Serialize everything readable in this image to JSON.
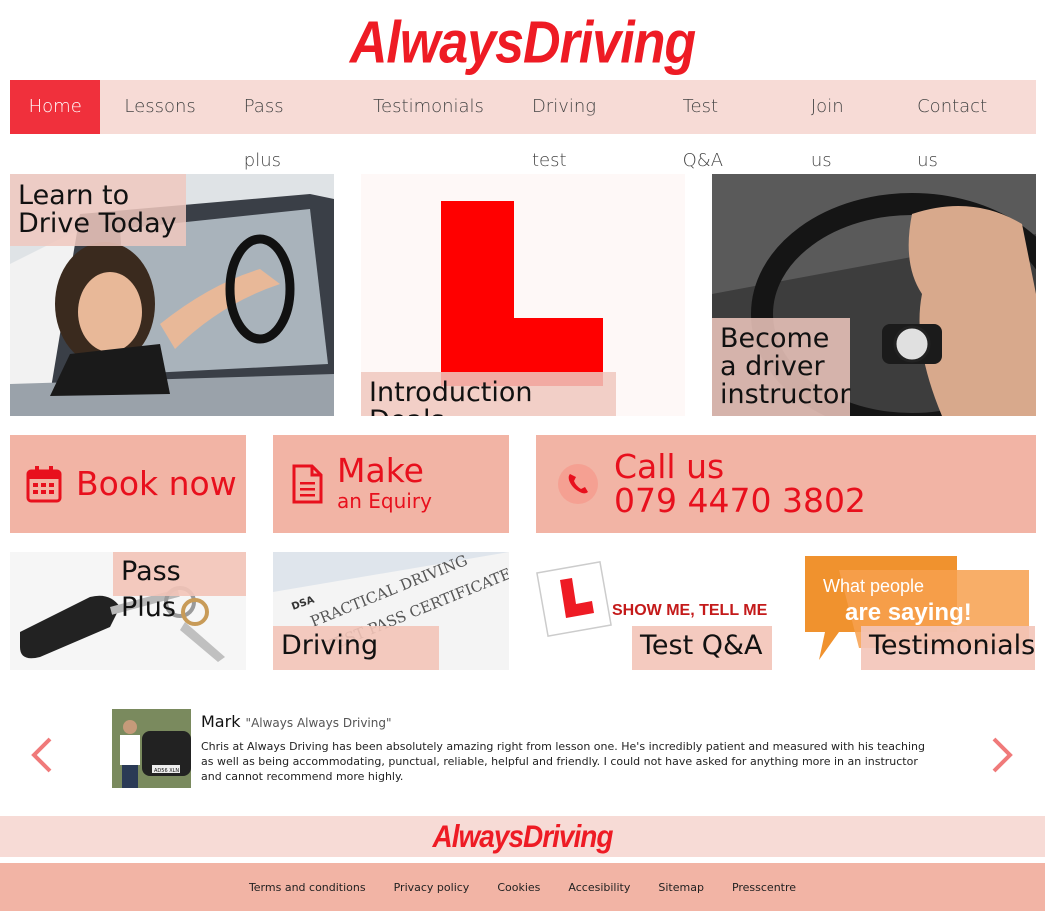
{
  "logo": {
    "text": "AlwaysDriving"
  },
  "nav": {
    "items": [
      {
        "label": "Home"
      },
      {
        "label": "Lessons"
      },
      {
        "label": "Pass plus"
      },
      {
        "label": "Testimonials"
      },
      {
        "label": "Driving test"
      },
      {
        "label": "Test Q&A"
      },
      {
        "label": "Join us"
      },
      {
        "label": "Contact us"
      }
    ]
  },
  "hero": {
    "learn": {
      "line1": "Learn to",
      "line2": "Drive Today"
    },
    "intro": {
      "caption": "Introduction Deals"
    },
    "instructor": {
      "line1": "Become",
      "line2": "a driver",
      "line3": "instructor"
    }
  },
  "cta": {
    "book": {
      "label": "Book now"
    },
    "enquiry": {
      "title": "Make",
      "sub": "an Equiry"
    },
    "call": {
      "title": "Call us",
      "phone": "079 4470 3802"
    }
  },
  "features": {
    "passplus": {
      "caption": "Pass Plus",
      "tag": ""
    },
    "drivingtest": {
      "caption": "Driving Test",
      "cert_line1": "PRACTICAL DRIVING",
      "cert_line2": "TEST PASS CERTIFICATE",
      "dsa": "DSA"
    },
    "testqa": {
      "caption": "Test Q&A",
      "banner": "SHOW ME, TELL ME"
    },
    "testimonials": {
      "caption": "Testimonials",
      "bubble1": "What people",
      "bubble2": "are saying!"
    }
  },
  "testimonial": {
    "name": "Mark",
    "org": "\"Always Always Driving\"",
    "body": "Chris at Always Driving has been absolutely amazing right from lesson one. He's incredibly patient and measured with his teaching as well as being accommodating, punctual, reliable, helpful and friendly. I could not have asked for anything more in an instructor and cannot recommend more highly.",
    "plate": "AD56 XLN"
  },
  "footer": {
    "logo": "AlwaysDriving",
    "links": [
      {
        "label": "Terms and conditions"
      },
      {
        "label": "Privacy policy"
      },
      {
        "label": "Cookies"
      },
      {
        "label": "Accesibility"
      },
      {
        "label": "Sitemap"
      },
      {
        "label": "Presscentre"
      }
    ]
  },
  "colors": {
    "brand": "#ee1b24",
    "nav_bg": "#f7dbd6",
    "cta_bg": "#f2b4a5",
    "active": "#f0303c"
  }
}
